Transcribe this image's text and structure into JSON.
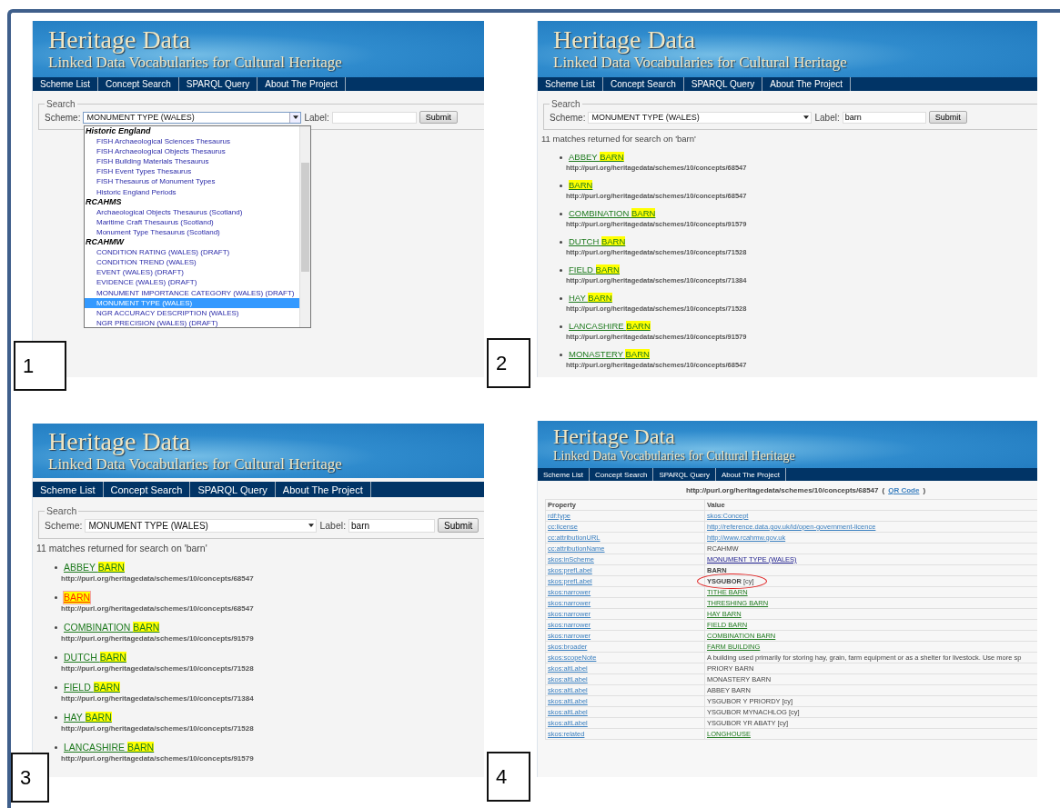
{
  "figure_panels": [
    {
      "kind": "search",
      "number": "1",
      "banner": {
        "title": "Heritage Data",
        "subtitle": "Linked Data Vocabularies for Cultural Heritage"
      },
      "nav": [
        "Scheme List",
        "Concept Search",
        "SPARQL Query",
        "About The Project"
      ],
      "search": {
        "legend": "Search",
        "scheme_label": "Scheme:",
        "scheme_value": "MONUMENT TYPE (WALES)",
        "label_label": "Label:",
        "submit": "Submit"
      },
      "dropdown": {
        "groups": [
          {
            "name": "Historic England",
            "options": [
              {
                "text": "FISH Archaeological Sciences Thesaurus",
                "selected": false
              },
              {
                "text": "FISH Archaeological Objects Thesaurus",
                "selected": false
              },
              {
                "text": "FISH Building Materials Thesaurus",
                "selected": false
              },
              {
                "text": "FISH Event Types Thesaurus",
                "selected": false
              },
              {
                "text": "FISH Thesaurus of Monument Types",
                "selected": false
              },
              {
                "text": "Historic England Periods",
                "selected": false
              }
            ]
          },
          {
            "name": "RCAHMS",
            "options": [
              {
                "text": "Archaeological Objects Thesaurus (Scotland)",
                "selected": false
              },
              {
                "text": "Maritime Craft Thesaurus (Scotland)",
                "selected": false
              },
              {
                "text": "Monument Type Thesaurus (Scotland)",
                "selected": false
              }
            ]
          },
          {
            "name": "RCAHMW",
            "options": [
              {
                "text": "CONDITION RATING (WALES) (DRAFT)",
                "selected": false
              },
              {
                "text": "CONDITION TREND (WALES)",
                "selected": false
              },
              {
                "text": "EVENT (WALES) (DRAFT)",
                "selected": false
              },
              {
                "text": "EVIDENCE (WALES) (DRAFT)",
                "selected": false
              },
              {
                "text": "MONUMENT IMPORTANCE CATEGORY (WALES) (DRAFT)",
                "selected": false
              },
              {
                "text": "MONUMENT TYPE (WALES)",
                "selected": true
              },
              {
                "text": "NGR ACCURACY DESCRIPTION (WALES)",
                "selected": false
              },
              {
                "text": "NGR PRECISION (WALES) (DRAFT)",
                "selected": false
              }
            ]
          }
        ]
      }
    },
    {
      "kind": "results",
      "number": "2",
      "banner": {
        "title": "Heritage Data",
        "subtitle": "Linked Data Vocabularies for Cultural Heritage"
      },
      "nav": [
        "Scheme List",
        "Concept Search",
        "SPARQL Query",
        "About The Project"
      ],
      "search": {
        "legend": "Search",
        "scheme_label": "Scheme:",
        "scheme_value": "MONUMENT TYPE (WALES)",
        "label_label": "Label:",
        "label_value": "barn",
        "submit": "Submit"
      },
      "summary": "11 matches returned for search on 'barn'",
      "results": [
        {
          "prefix": "ABBEY ",
          "match": "BARN",
          "uri": "http://purl.org/heritagedata/schemes/10/concepts/68547",
          "focused": false
        },
        {
          "match": "BARN",
          "uri": "http://purl.org/heritagedata/schemes/10/concepts/68547",
          "focused": false
        },
        {
          "prefix": "COMBINATION ",
          "match": "BARN",
          "uri": "http://purl.org/heritagedata/schemes/10/concepts/91579",
          "focused": false
        },
        {
          "prefix": "DUTCH ",
          "match": "BARN",
          "uri": "http://purl.org/heritagedata/schemes/10/concepts/71528",
          "focused": false
        },
        {
          "prefix": "FIELD ",
          "match": "BARN",
          "uri": "http://purl.org/heritagedata/schemes/10/concepts/71384",
          "focused": false
        },
        {
          "prefix": "HAY ",
          "match": "BARN",
          "uri": "http://purl.org/heritagedata/schemes/10/concepts/71528",
          "focused": false
        },
        {
          "prefix": "LANCASHIRE ",
          "match": "BARN",
          "uri": "http://purl.org/heritagedata/schemes/10/concepts/91579",
          "focused": false
        },
        {
          "prefix": "MONASTERY ",
          "match": "BARN",
          "uri": "http://purl.org/heritagedata/schemes/10/concepts/68547",
          "focused": false
        }
      ]
    },
    {
      "kind": "results",
      "number": "3",
      "banner": {
        "title": "Heritage Data",
        "subtitle": "Linked Data Vocabularies for Cultural Heritage"
      },
      "nav": [
        "Scheme List",
        "Concept Search",
        "SPARQL Query",
        "About The Project"
      ],
      "search": {
        "legend": "Search",
        "scheme_label": "Scheme:",
        "scheme_value": "MONUMENT TYPE (WALES)",
        "label_label": "Label:",
        "label_value": "barn",
        "submit": "Submit"
      },
      "summary": "11 matches returned for search on 'barn'",
      "results": [
        {
          "prefix": "ABBEY ",
          "match": "BARN",
          "uri": "http://purl.org/heritagedata/schemes/10/concepts/68547",
          "focused": false
        },
        {
          "match": "BARN",
          "uri": "http://purl.org/heritagedata/schemes/10/concepts/68547",
          "focused": true
        },
        {
          "prefix": "COMBINATION ",
          "match": "BARN",
          "uri": "http://purl.org/heritagedata/schemes/10/concepts/91579",
          "focused": false
        },
        {
          "prefix": "DUTCH ",
          "match": "BARN",
          "uri": "http://purl.org/heritagedata/schemes/10/concepts/71528",
          "focused": false
        },
        {
          "prefix": "FIELD ",
          "match": "BARN",
          "uri": "http://purl.org/heritagedata/schemes/10/concepts/71384",
          "focused": false
        },
        {
          "prefix": "HAY ",
          "match": "BARN",
          "uri": "http://purl.org/heritagedata/schemes/10/concepts/71528",
          "focused": false
        },
        {
          "prefix": "LANCASHIRE ",
          "match": "BARN",
          "uri": "http://purl.org/heritagedata/schemes/10/concepts/91579",
          "focused": false
        }
      ]
    },
    {
      "kind": "concept",
      "number": "4",
      "banner": {
        "title": "Heritage Data",
        "subtitle": "Linked Data Vocabularies for Cultural Heritage"
      },
      "nav": [
        "Scheme List",
        "Concept Search",
        "SPARQL Query",
        "About The Project"
      ],
      "uri_heading": "http://purl.org/heritagedata/schemes/10/concepts/68547",
      "qr_open": "(",
      "qr_link": "QR Code",
      "qr_close": ")",
      "table": {
        "columns": [
          "Property",
          "Value"
        ],
        "rows": [
          {
            "property": "rdf:type",
            "value": "skos:Concept",
            "kind": "uri_link"
          },
          {
            "property": "cc:license",
            "value": "http://reference.data.gov.uk/id/open-government-licence",
            "kind": "uri_link"
          },
          {
            "property": "cc:attributionURL",
            "value": "http://www.rcahmw.gov.uk",
            "kind": "uri_link"
          },
          {
            "property": "cc:attributionName",
            "value": "RCAHMW",
            "kind": "text"
          },
          {
            "property": "skos:inScheme",
            "value": "MONUMENT TYPE (WALES)",
            "kind": "scheme_link"
          },
          {
            "property": "skos:prefLabel",
            "value": "BARN",
            "kind": "bold"
          },
          {
            "property": "skos:prefLabel",
            "value": "**YSGUBOR** [cy]",
            "kind": "text",
            "annotated": true
          },
          {
            "property": "skos:narrower",
            "value": "TITHE BARN",
            "kind": "concept_link"
          },
          {
            "property": "skos:narrower",
            "value": "THRESHING BARN",
            "kind": "concept_link"
          },
          {
            "property": "skos:narrower",
            "value": "HAY BARN",
            "kind": "concept_link"
          },
          {
            "property": "skos:narrower",
            "value": "FIELD BARN",
            "kind": "concept_link"
          },
          {
            "property": "skos:narrower",
            "value": "COMBINATION BARN",
            "kind": "concept_link"
          },
          {
            "property": "skos:broader",
            "value": "FARM BUILDING",
            "kind": "concept_link"
          },
          {
            "property": "skos:scopeNote",
            "value": "A building used primarily for storing hay, grain, farm equipment or as a shelter for livestock. Use more sp",
            "kind": "text"
          },
          {
            "property": "skos:altLabel",
            "value": "PRIORY BARN",
            "kind": "text"
          },
          {
            "property": "skos:altLabel",
            "value": "MONASTERY BARN",
            "kind": "text"
          },
          {
            "property": "skos:altLabel",
            "value": "ABBEY BARN",
            "kind": "text"
          },
          {
            "property": "skos:altLabel",
            "value": "YSGUBOR Y PRIORDY [cy]",
            "kind": "text"
          },
          {
            "property": "skos:altLabel",
            "value": "YSGUBOR MYNACHLOG [cy]",
            "kind": "text"
          },
          {
            "property": "skos:altLabel",
            "value": "YSGUBOR YR ABATY [cy]",
            "kind": "text"
          },
          {
            "property": "skos:related",
            "value": "LONGHOUSE",
            "kind": "concept_link"
          }
        ]
      }
    }
  ]
}
